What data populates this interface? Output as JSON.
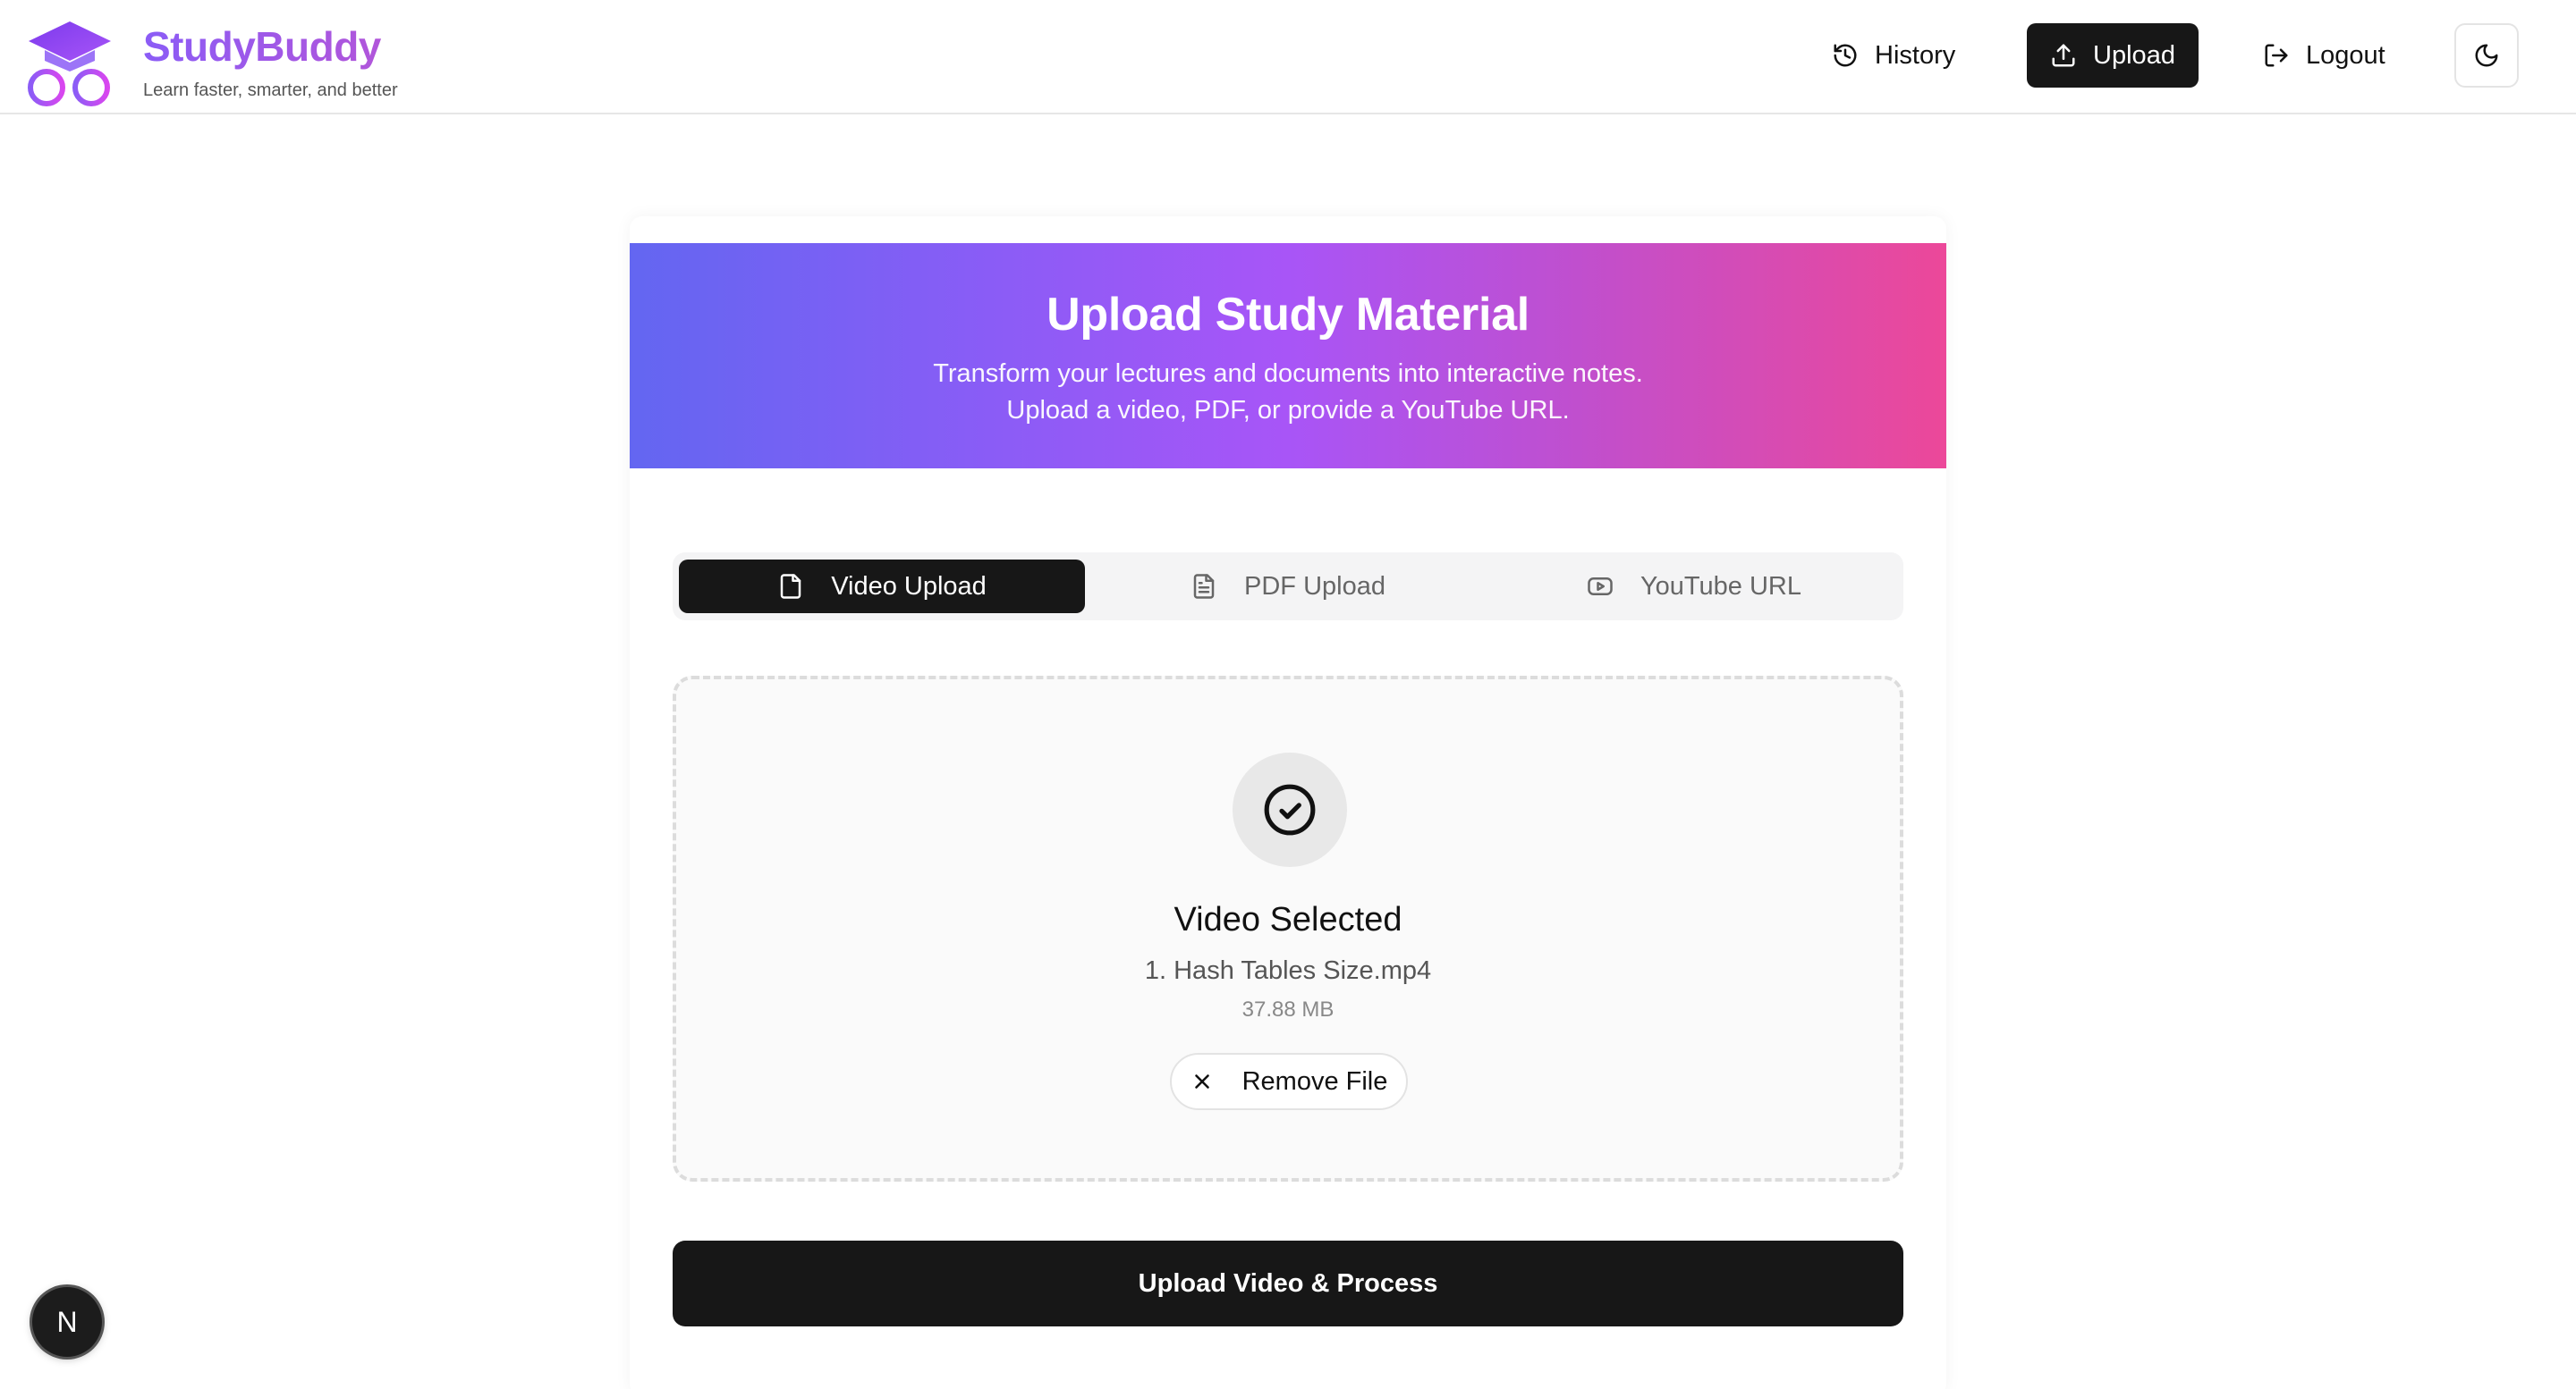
{
  "brand": {
    "name": "StudyBuddy",
    "tagline": "Learn faster, smarter, and better"
  },
  "nav": {
    "history_label": "History",
    "upload_label": "Upload",
    "logout_label": "Logout"
  },
  "hero": {
    "title": "Upload Study Material",
    "line1": "Transform your lectures and documents into interactive notes.",
    "line2": "Upload a video, PDF, or provide a YouTube URL."
  },
  "tabs": [
    {
      "label": "Video Upload",
      "active": true
    },
    {
      "label": "PDF Upload",
      "active": false
    },
    {
      "label": "YouTube URL",
      "active": false
    }
  ],
  "selection": {
    "title": "Video Selected",
    "file_name": "1. Hash Tables Size.mp4",
    "file_size": "37.88 MB",
    "remove_label": "Remove File"
  },
  "submit_label": "Upload Video & Process",
  "dev_badge": "N",
  "colors": {
    "primary_dark": "#171717",
    "gradient_start": "#6366f1",
    "gradient_mid": "#a855f7",
    "gradient_end": "#ec4899"
  }
}
